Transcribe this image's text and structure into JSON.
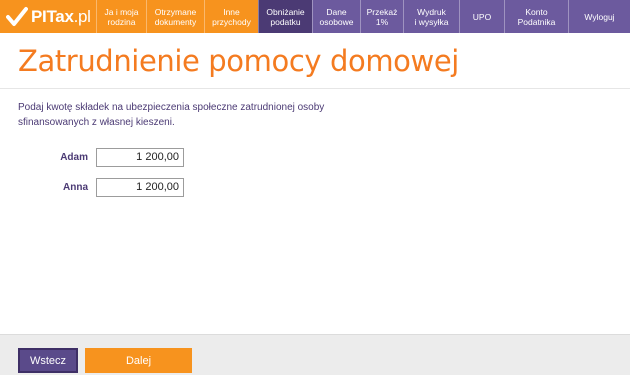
{
  "logo": {
    "text_bold": "PITax",
    "text_thin": ".pl",
    "icon": "checkmark-logo-icon"
  },
  "nav": [
    {
      "label": "Ja i moja\nrodzina"
    },
    {
      "label": "Otrzymane\ndokumenty"
    },
    {
      "label": "Inne\nprzychody"
    },
    {
      "label": "Obniżanie\npodatku"
    },
    {
      "label": "Dane\nosobowe"
    },
    {
      "label": "Przekaż\n1%"
    },
    {
      "label": "Wydruk\ni wysyłka"
    },
    {
      "label": "UPO"
    },
    {
      "label": "Konto\nPodatnika"
    },
    {
      "label": "Wyloguj"
    }
  ],
  "page": {
    "title": "Zatrudnienie pomocy domowej",
    "intro": "Podaj kwotę składek na ubezpieczenia społeczne zatrudnionej osoby sfinansowanych z własnej kieszeni."
  },
  "persons": [
    {
      "name": "Adam",
      "amount": "1 200,00"
    },
    {
      "name": "Anna",
      "amount": "1 200,00"
    }
  ],
  "footer": {
    "back_label": "Wstecz",
    "next_label": "Dalej"
  },
  "colors": {
    "orange": "#f7931e",
    "title_orange": "#f47b20",
    "purple": "#4b3a74"
  }
}
